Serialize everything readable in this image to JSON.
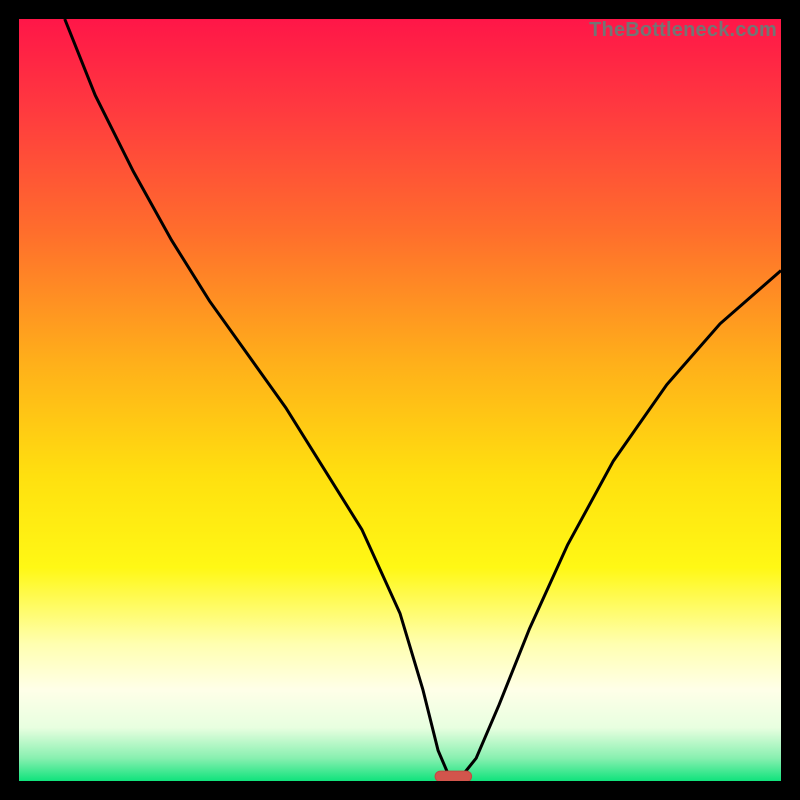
{
  "watermark": "TheBottleneck.com",
  "colors": {
    "gradient_stops": [
      {
        "offset": 0.0,
        "color": "#ff1648"
      },
      {
        "offset": 0.12,
        "color": "#ff3a3f"
      },
      {
        "offset": 0.28,
        "color": "#ff6e2c"
      },
      {
        "offset": 0.45,
        "color": "#ffaf1a"
      },
      {
        "offset": 0.6,
        "color": "#ffe00f"
      },
      {
        "offset": 0.72,
        "color": "#fff815"
      },
      {
        "offset": 0.82,
        "color": "#ffffb0"
      },
      {
        "offset": 0.88,
        "color": "#ffffe8"
      },
      {
        "offset": 0.93,
        "color": "#e8ffe0"
      },
      {
        "offset": 0.97,
        "color": "#88f0b0"
      },
      {
        "offset": 1.0,
        "color": "#10e37c"
      }
    ],
    "curve": "#000000",
    "marker_fill": "#d2554c",
    "marker_stroke": "#c24a42"
  },
  "chart_data": {
    "type": "line",
    "title": "",
    "xlabel": "",
    "ylabel": "",
    "xlim": [
      0,
      100
    ],
    "ylim": [
      0,
      100
    ],
    "series": [
      {
        "name": "bottleneck-curve",
        "x": [
          6,
          10,
          15,
          20,
          25,
          30,
          35,
          40,
          45,
          50,
          53,
          55,
          56.5,
          58,
          60,
          63,
          67,
          72,
          78,
          85,
          92,
          100
        ],
        "values": [
          100,
          90,
          80,
          71,
          63,
          56,
          49,
          41,
          33,
          22,
          12,
          4,
          0.5,
          0.5,
          3,
          10,
          20,
          31,
          42,
          52,
          60,
          67
        ]
      }
    ],
    "marker": {
      "name": "optimal-point",
      "x_center": 57,
      "y": 0.6,
      "width_x_units": 4.8,
      "height_y_units": 1.4
    }
  }
}
